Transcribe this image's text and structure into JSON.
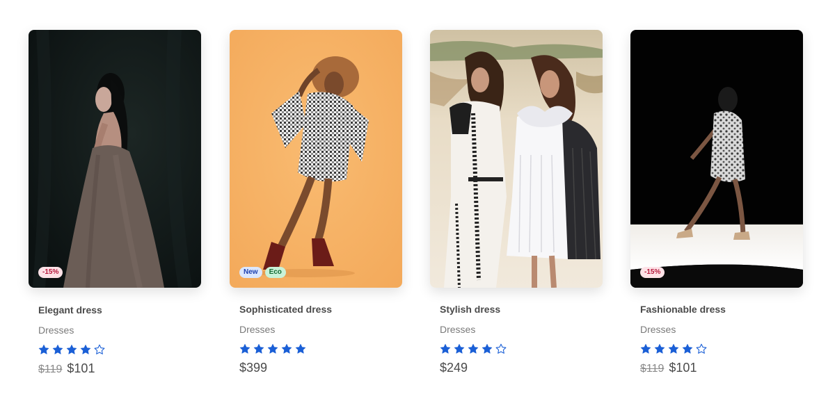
{
  "products": [
    {
      "name": "Elegant dress",
      "category": "Dresses",
      "rating": 4,
      "rating_max": 5,
      "old_price": "$119",
      "price": "$101",
      "badges": [
        {
          "text": "-15%",
          "kind": "discount"
        }
      ]
    },
    {
      "name": "Sophisticated dress",
      "category": "Dresses",
      "rating": 5,
      "rating_max": 5,
      "old_price": null,
      "price": "$399",
      "badges": [
        {
          "text": "New",
          "kind": "new"
        },
        {
          "text": "Eco",
          "kind": "eco"
        }
      ]
    },
    {
      "name": "Stylish dress",
      "category": "Dresses",
      "rating": 4,
      "rating_max": 5,
      "old_price": null,
      "price": "$249",
      "badges": []
    },
    {
      "name": "Fashionable dress",
      "category": "Dresses",
      "rating": 4,
      "rating_max": 5,
      "old_price": "$119",
      "price": "$101",
      "badges": [
        {
          "text": "-15%",
          "kind": "discount"
        }
      ]
    }
  ],
  "colors": {
    "star": "#1a5fd6",
    "text": "#4a4a4a",
    "muted": "#7a7a7a"
  },
  "icons": {
    "star_filled": "star-filled-icon",
    "star_empty": "star-outline-icon"
  }
}
